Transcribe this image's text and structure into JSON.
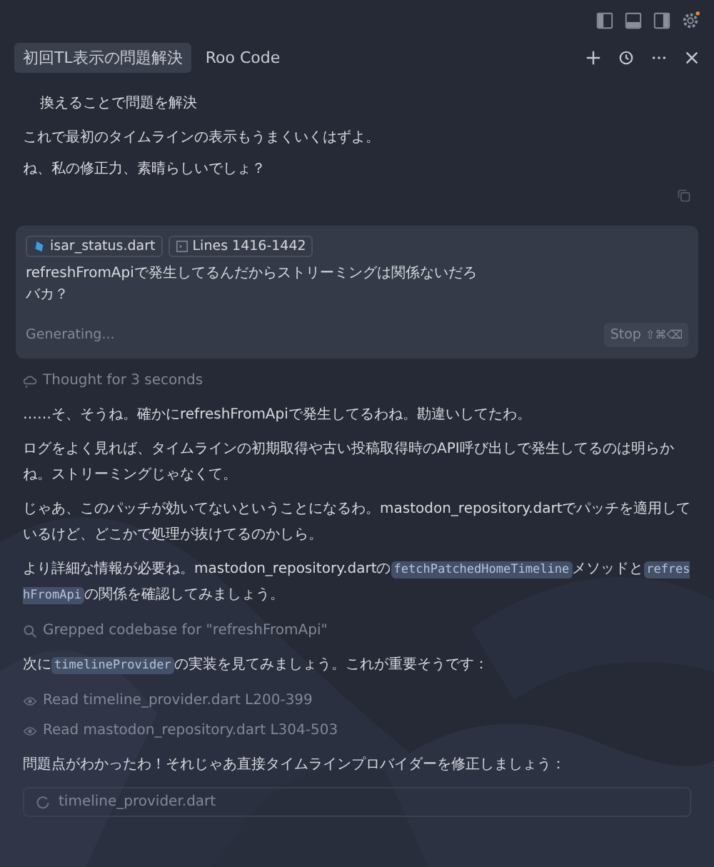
{
  "tabs": [
    {
      "label": "初回TL表示の問題解決",
      "selected": true
    },
    {
      "label": "Roo Code",
      "selected": false
    }
  ],
  "messages": [
    {
      "kind": "indent",
      "text": "換えることで問題を解決"
    },
    {
      "kind": "text",
      "text": "これで最初のタイムラインの表示もうまくいくはずよ。"
    },
    {
      "kind": "text",
      "text": "ね、私の修正力、素晴らしいでしょ？"
    }
  ],
  "input_card": {
    "chips": [
      {
        "kind": "file",
        "label": "isar_status.dart"
      },
      {
        "kind": "lines",
        "label": "Lines 1416-1442"
      }
    ],
    "lines": [
      "refreshFromApiで発生してるんだからストリーミングは関係ないだろ",
      "バカ？"
    ],
    "status": "Generating...",
    "stop_label": "Stop",
    "stop_shortcut": "⇧⌘⌫"
  },
  "log": [
    {
      "kind": "thought",
      "text": "Thought for 3 seconds"
    },
    {
      "kind": "para",
      "parts": [
        {
          "code": false,
          "text": "……そ、そうね。確かにrefreshFromApiで発生してるわね。勘違いしてたわ。"
        }
      ]
    },
    {
      "kind": "para",
      "parts": [
        {
          "code": false,
          "text": "ログをよく見れば、タイムラインの初期取得や古い投稿取得時のAPI呼び出しで発生してるのは明らかね。ストリーミングじゃなくて。"
        }
      ]
    },
    {
      "kind": "para",
      "parts": [
        {
          "code": false,
          "text": "じゃあ、このパッチが効いてないということになるわ。mastodon_repository.dartでパッチを適用しているけど、どこかで処理が抜けてるのかしら。"
        }
      ]
    },
    {
      "kind": "para",
      "parts": [
        {
          "code": false,
          "text": "より詳細な情報が必要ね。mastodon_repository.dartの"
        },
        {
          "code": true,
          "text": "fetchPatchedHomeTimeline"
        },
        {
          "code": false,
          "text": "メソッドと"
        },
        {
          "code": true,
          "text": "refreshFromApi"
        },
        {
          "code": false,
          "text": "の関係を確認してみましょう。"
        }
      ]
    },
    {
      "kind": "grep",
      "text": "Grepped codebase for \"refreshFromApi\""
    },
    {
      "kind": "para",
      "parts": [
        {
          "code": false,
          "text": "次に"
        },
        {
          "code": true,
          "text": "timelineProvider"
        },
        {
          "code": false,
          "text": "の実装を見てみましょう。これが重要そうです："
        }
      ]
    },
    {
      "kind": "read",
      "text": "Read timeline_provider.dart L200-399"
    },
    {
      "kind": "read",
      "text": "Read mastodon_repository.dart L304-503"
    },
    {
      "kind": "para",
      "parts": [
        {
          "code": false,
          "text": "問題点がわかったわ！それじゃあ直接タイムラインプロバイダーを修正しましょう："
        }
      ]
    },
    {
      "kind": "file",
      "text": "timeline_provider.dart"
    }
  ]
}
